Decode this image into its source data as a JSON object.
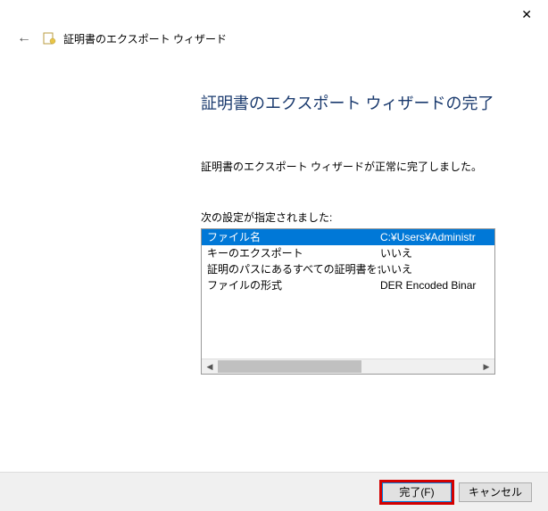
{
  "header": {
    "title": "証明書のエクスポート ウィザード"
  },
  "main": {
    "title": "証明書のエクスポート ウィザードの完了",
    "status": "証明書のエクスポート ウィザードが正常に完了しました。",
    "settings_label": "次の設定が指定されました:",
    "rows": [
      {
        "key": "ファイル名",
        "value": "C:¥Users¥Administr",
        "selected": true
      },
      {
        "key": "キーのエクスポート",
        "value": "いいえ",
        "selected": false
      },
      {
        "key": "証明のパスにあるすべての証明書を含める",
        "value": "いいえ",
        "selected": false
      },
      {
        "key": "ファイルの形式",
        "value": "DER Encoded Binar",
        "selected": false
      }
    ]
  },
  "buttons": {
    "finish": "完了(F)",
    "cancel": "キャンセル"
  }
}
